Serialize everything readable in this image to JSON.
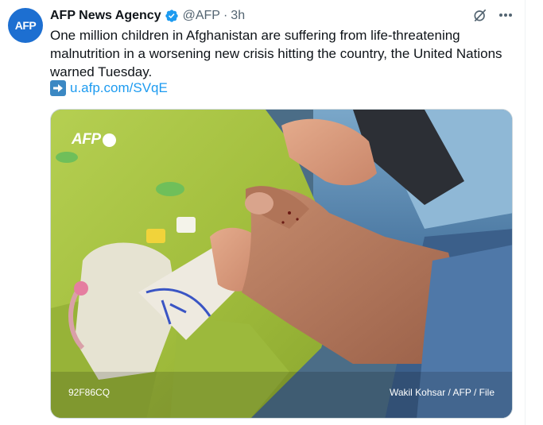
{
  "tweet": {
    "avatar_text": "AFP",
    "author": "AFP News Agency",
    "handle": "@AFP",
    "separator": "·",
    "time": "3h",
    "text": "One million children in Afghanistan are suffering from life-threatening malnutrition in a worsening new crisis hitting the country, the United Nations warned Tuesday.",
    "link": "u.afp.com/SVqE"
  },
  "media": {
    "watermark": "AFP",
    "photo_id": "92F86CQ",
    "credit": "Wakil Kohsar / AFP / File"
  },
  "icons": [
    "verified-badge-icon",
    "grok-icon",
    "more-icon",
    "right-arrow-icon"
  ],
  "colors": {
    "link": "#1d9bf0",
    "verified": "#1d9bf0",
    "avatar": "#1d6fd1",
    "muted": "#536471"
  }
}
